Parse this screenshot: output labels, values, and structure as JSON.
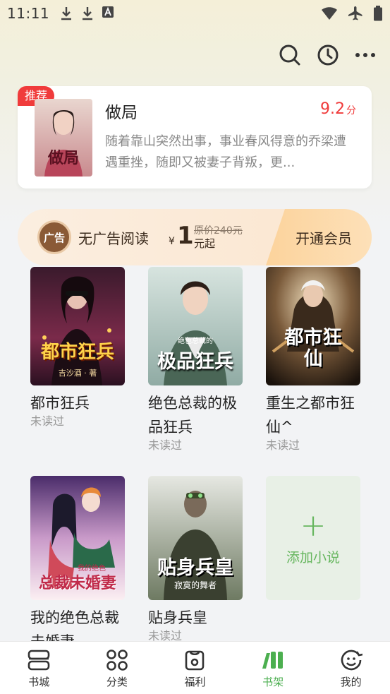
{
  "status_bar": {
    "time": "11:11"
  },
  "recommend": {
    "badge": "推荐",
    "title": "做局",
    "score": "9.2",
    "score_unit": "分",
    "description": "随着靠山突然出事，事业春风得意的乔梁遭遇重挫，随即又被妻子背叛，更...",
    "cover_text": "做局"
  },
  "vip": {
    "label": "无广告阅读",
    "icon_text": "广告",
    "currency": "¥",
    "price": "1",
    "original_price": "原价240元",
    "price_suffix": "元起",
    "cta": "开通会员"
  },
  "books": [
    {
      "title": "都市狂兵",
      "status": "未读过",
      "cover_text": "都市狂兵",
      "cover_sub": "吉沙酒 · 著"
    },
    {
      "title": "绝色总裁的极品狂兵",
      "status": "未读过",
      "cover_text": "极品狂兵",
      "cover_sub": "绝色总裁的"
    },
    {
      "title": "重生之都市狂仙^",
      "status": "未读过",
      "cover_text": "都市狂仙",
      "cover_sub": ""
    },
    {
      "title": "我的绝色总裁未婚妻",
      "status": "",
      "cover_text": "总裁未婚妻",
      "cover_sub": "我的绝色"
    },
    {
      "title": "贴身兵皇",
      "status": "未读过",
      "cover_text": "贴身兵皇",
      "cover_sub": "寂寞的舞者"
    }
  ],
  "add_card": {
    "label": "添加小说",
    "plus": "+"
  },
  "nav": [
    {
      "label": "书城",
      "icon": "bookstore-icon"
    },
    {
      "label": "分类",
      "icon": "category-icon"
    },
    {
      "label": "福利",
      "icon": "welfare-icon"
    },
    {
      "label": "书架",
      "icon": "bookshelf-icon",
      "active": true
    },
    {
      "label": "我的",
      "icon": "profile-icon"
    }
  ],
  "colors": {
    "accent": "#4caf50",
    "score": "#f03b3b",
    "vip_text": "#3a2a1c"
  }
}
